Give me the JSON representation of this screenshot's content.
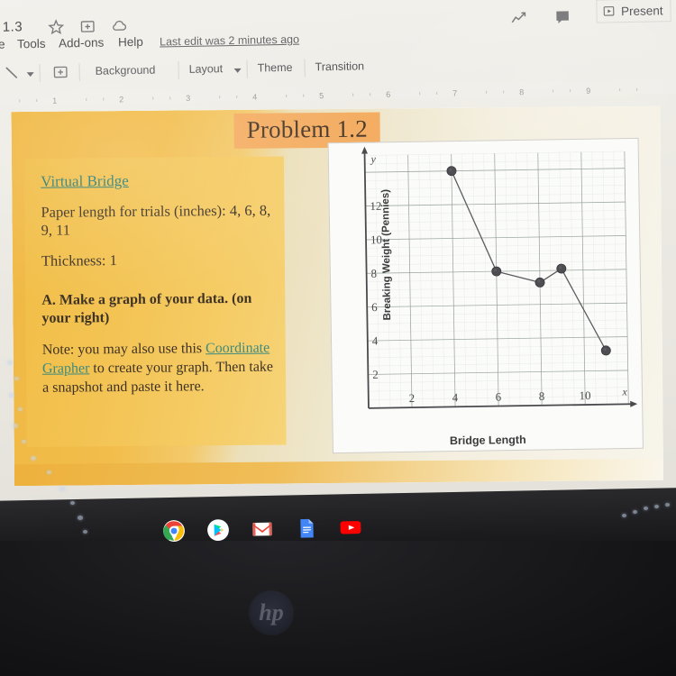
{
  "app": {
    "doc_title_fragment": "1.3",
    "last_edit": "Last edit was 2 minutes ago",
    "present_label": "Present"
  },
  "top_icons": [
    {
      "name": "star-icon",
      "glyph": "star"
    },
    {
      "name": "move-to-folder-icon",
      "glyph": "folder-move"
    },
    {
      "name": "cloud-saved-icon",
      "glyph": "cloud"
    }
  ],
  "menu": {
    "items": [
      {
        "label": "nge"
      },
      {
        "label": "Tools"
      },
      {
        "label": "Add-ons"
      },
      {
        "label": "Help"
      }
    ]
  },
  "toolbar": {
    "items": [
      {
        "label": "Background"
      },
      {
        "label": "Layout",
        "has_caret": true
      },
      {
        "label": "Theme"
      },
      {
        "label": "Transition"
      }
    ],
    "line_tool": "line-tool",
    "textbox_tool": "textbox-tool"
  },
  "right_toolbar": [
    {
      "name": "explore-trend-icon"
    },
    {
      "name": "comment-icon"
    }
  ],
  "ruler": {
    "ticks": [
      "1",
      "2",
      "3",
      "4",
      "5",
      "6",
      "7",
      "8",
      "9"
    ]
  },
  "slide": {
    "title": "Problem 1.2",
    "text_card": {
      "heading_link": "Virtual Bridge",
      "paragraph1": "Paper length for trials (inches): 4, 6, 8, 9, 11",
      "paragraph2": "Thickness: 1",
      "task": "A. Make a graph of your data. (on your right)",
      "note_prefix": "Note: you may also use this ",
      "note_link": "Coordinate Grapher",
      "note_suffix": " to create your graph. Then take a snapshot and paste it here."
    }
  },
  "chart_data": {
    "type": "line",
    "title": "",
    "xlabel": "Bridge Length",
    "ylabel": "Breaking Weight (Pennies)",
    "axis_letters": {
      "x": "x",
      "y": "y"
    },
    "xlim": [
      0,
      12
    ],
    "ylim": [
      0,
      15
    ],
    "xticks": [
      2,
      4,
      6,
      8,
      10
    ],
    "yticks": [
      2,
      4,
      6,
      8,
      10,
      12
    ],
    "grid": true,
    "legend": "none",
    "x": [
      4,
      6,
      8,
      9,
      11
    ],
    "values": [
      14,
      8,
      7.3,
      8.1,
      3.2
    ],
    "series": [
      {
        "name": "Breaking Weight",
        "points": [
          {
            "x": 4,
            "y": 14
          },
          {
            "x": 6,
            "y": 8
          },
          {
            "x": 8,
            "y": 7.3
          },
          {
            "x": 9,
            "y": 8.1
          },
          {
            "x": 11,
            "y": 3.2
          }
        ]
      }
    ]
  },
  "taskbar": {
    "apps": [
      {
        "name": "chrome-icon"
      },
      {
        "name": "play-store-icon"
      },
      {
        "name": "gmail-icon"
      },
      {
        "name": "google-docs-icon"
      },
      {
        "name": "youtube-icon"
      }
    ]
  },
  "hardware": {
    "brand": "hp"
  },
  "colors": {
    "slide_accent": "#f1bd45",
    "title_highlight": "#f4ad62",
    "link_teal": "#2e7d72",
    "chart_ink": "#4a4a4e"
  }
}
